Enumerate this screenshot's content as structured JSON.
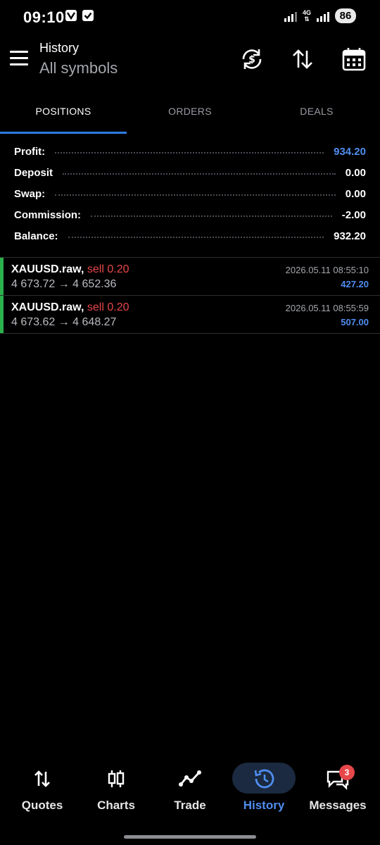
{
  "status_bar": {
    "time": "09:10",
    "network": "4G",
    "battery": "86"
  },
  "header": {
    "title": "History",
    "subtitle": "All symbols",
    "icons": [
      "currency-exchange-icon",
      "sort-icon",
      "calendar-icon"
    ]
  },
  "tabs": [
    {
      "label": "POSITIONS",
      "active": true
    },
    {
      "label": "ORDERS",
      "active": false
    },
    {
      "label": "DEALS",
      "active": false
    }
  ],
  "summary": [
    {
      "label": "Profit:",
      "value": "934.20",
      "highlight": true
    },
    {
      "label": "Deposit",
      "value": "0.00",
      "highlight": false
    },
    {
      "label": "Swap:",
      "value": "0.00",
      "highlight": false
    },
    {
      "label": "Commission:",
      "value": "-2.00",
      "highlight": false
    },
    {
      "label": "Balance:",
      "value": "932.20",
      "highlight": false
    }
  ],
  "trades": [
    {
      "symbol": "XAUUSD.raw,",
      "side": "sell 0.20",
      "prices": "4 673.72 → 4 652.36",
      "time": "2026.05.11 08:55:10",
      "profit": "427.20"
    },
    {
      "symbol": "XAUUSD.raw,",
      "side": "sell 0.20",
      "prices": "4 673.62 → 4 648.27",
      "time": "2026.05.11 08:55:59",
      "profit": "507.00"
    }
  ],
  "bottom_nav": [
    {
      "label": "Quotes",
      "icon": "quotes-arrows-icon",
      "active": false
    },
    {
      "label": "Charts",
      "icon": "candlestick-icon",
      "active": false
    },
    {
      "label": "Trade",
      "icon": "trend-line-icon",
      "active": false
    },
    {
      "label": "History",
      "icon": "history-clock-icon",
      "active": true
    },
    {
      "label": "Messages",
      "icon": "chat-bubbles-icon",
      "active": false,
      "badge": "3"
    }
  ],
  "colors": {
    "accent": "#2f7de1",
    "profit_blue": "#4f8ef0",
    "sell_red": "#e8474a",
    "buy_bar_green": "#2bb14b",
    "background": "#000000"
  }
}
